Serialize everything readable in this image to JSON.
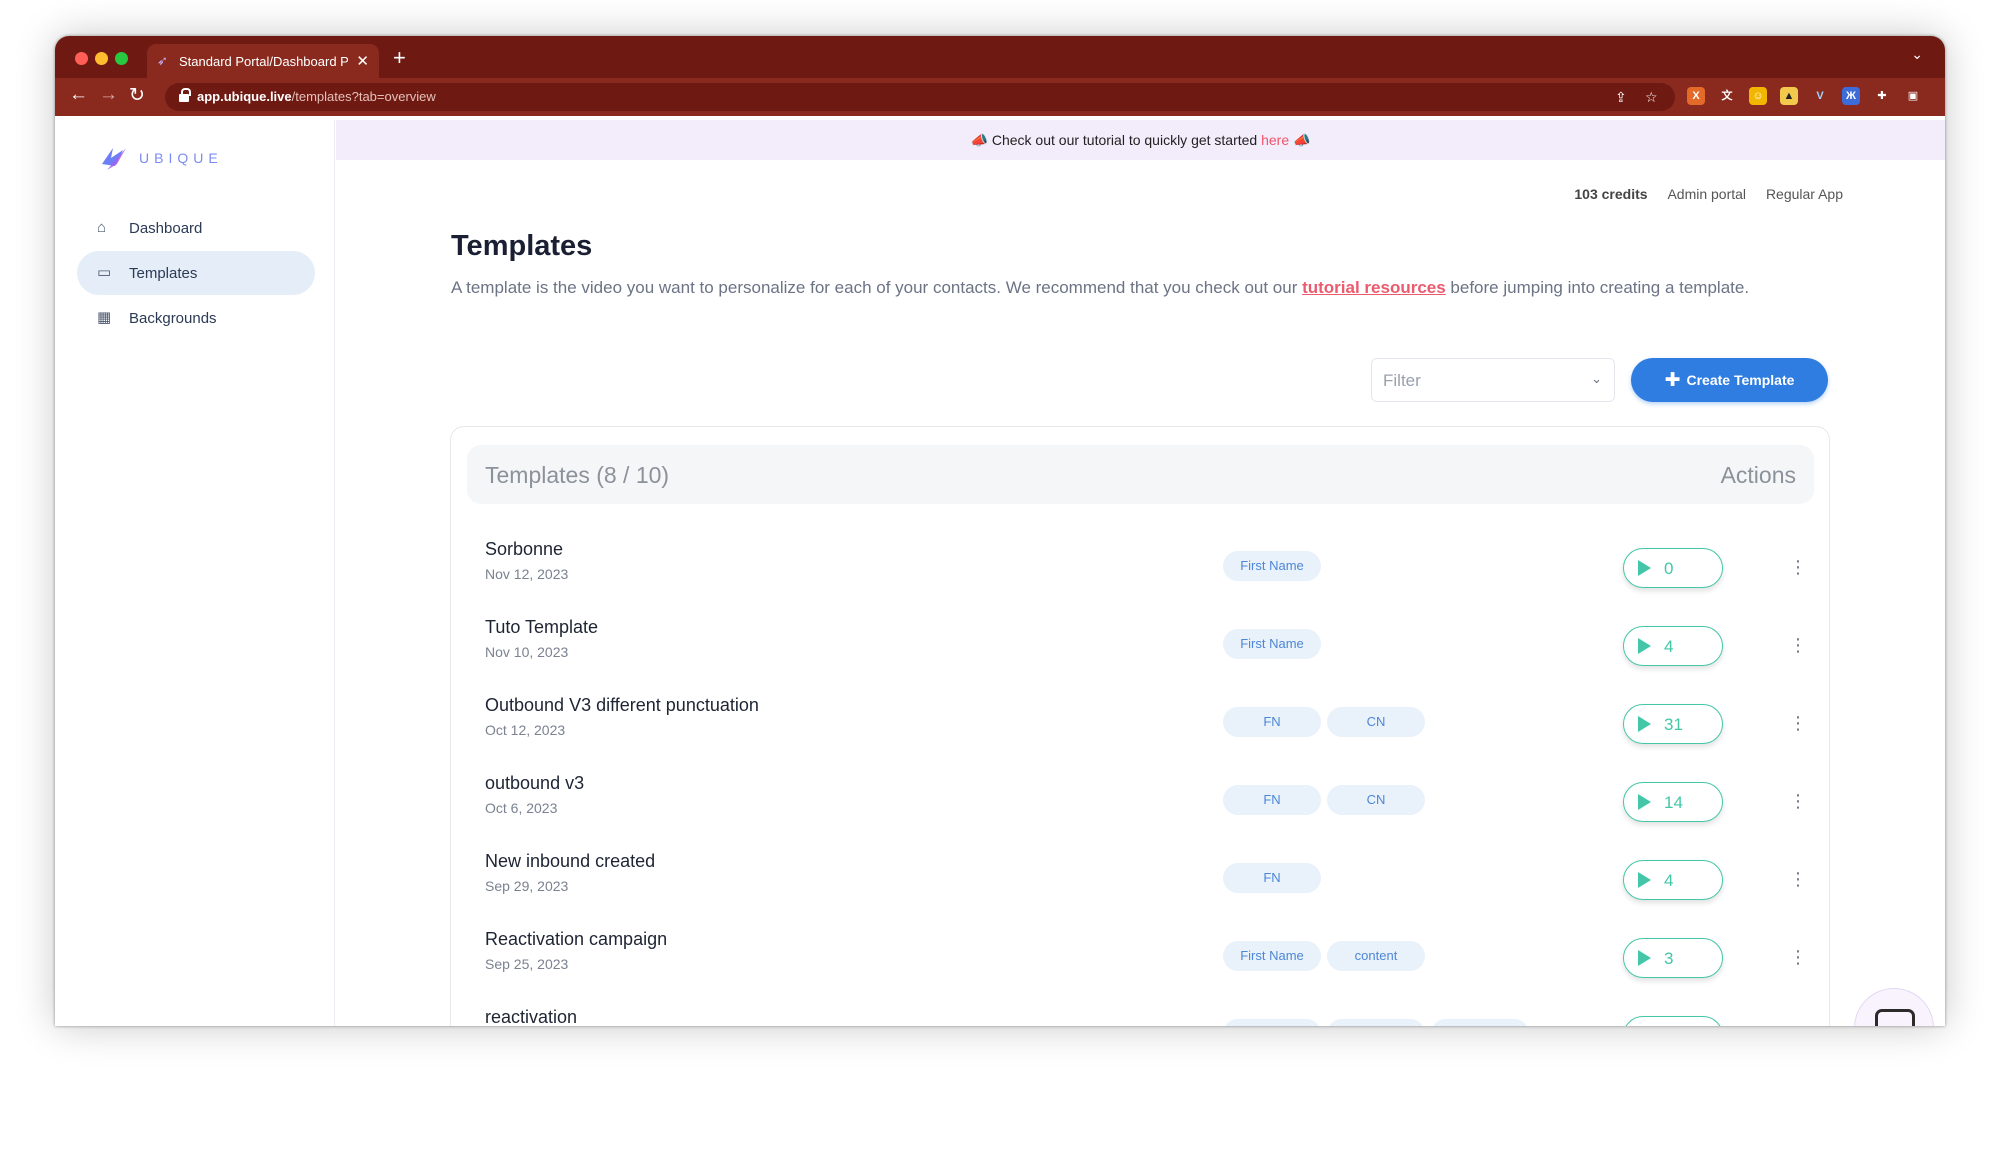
{
  "browser": {
    "tab_title": "Standard Portal/Dashboard Pa",
    "url_domain": "app.ubique.live",
    "url_path": "/templates?tab=overview"
  },
  "brand": {
    "logo_text": "UBIQUE"
  },
  "sidebar": {
    "items": [
      {
        "label": "Dashboard",
        "icon": "home-icon"
      },
      {
        "label": "Templates",
        "icon": "chat-bubble-icon",
        "active": true
      },
      {
        "label": "Backgrounds",
        "icon": "calendar-icon"
      }
    ]
  },
  "banner": {
    "text": "Check out our tutorial to quickly get started",
    "link": "here",
    "emoji": "📣"
  },
  "header": {
    "credits": "103 credits",
    "admin_portal": "Admin portal",
    "regular_app": "Regular App"
  },
  "page": {
    "title": "Templates",
    "desc_before": "A template is the video you want to personalize for each of your contacts.  We recommend that you check out our ",
    "desc_link": "tutorial resources",
    "desc_after": " before jumping into creating a template."
  },
  "controls": {
    "filter_placeholder": "Filter",
    "create_label": "Create Template"
  },
  "table": {
    "title": "Templates (8 / 10)",
    "actions_label": "Actions",
    "rows": [
      {
        "name": "Sorbonne",
        "date": "Nov 12, 2023",
        "tags": [
          "First Name"
        ],
        "count": "0"
      },
      {
        "name": "Tuto Template",
        "date": "Nov 10, 2023",
        "tags": [
          "First Name"
        ],
        "count": "4"
      },
      {
        "name": "Outbound V3 different punctuation",
        "date": "Oct 12, 2023",
        "tags": [
          "FN",
          "CN"
        ],
        "count": "31"
      },
      {
        "name": "outbound v3",
        "date": "Oct 6, 2023",
        "tags": [
          "FN",
          "CN"
        ],
        "count": "14"
      },
      {
        "name": "New inbound created",
        "date": "Sep 29, 2023",
        "tags": [
          "FN"
        ],
        "count": "4"
      },
      {
        "name": "Reactivation campaign",
        "date": "Sep 25, 2023",
        "tags": [
          "First Name",
          "content"
        ],
        "count": "3"
      },
      {
        "name": "reactivation",
        "date": "",
        "tags": [
          "",
          "",
          ""
        ],
        "count": ""
      }
    ]
  },
  "colors": {
    "chrome": "#8a2a1e",
    "accent": "#2f7de1",
    "play": "#43c7a8",
    "link": "#ec5a6e"
  }
}
